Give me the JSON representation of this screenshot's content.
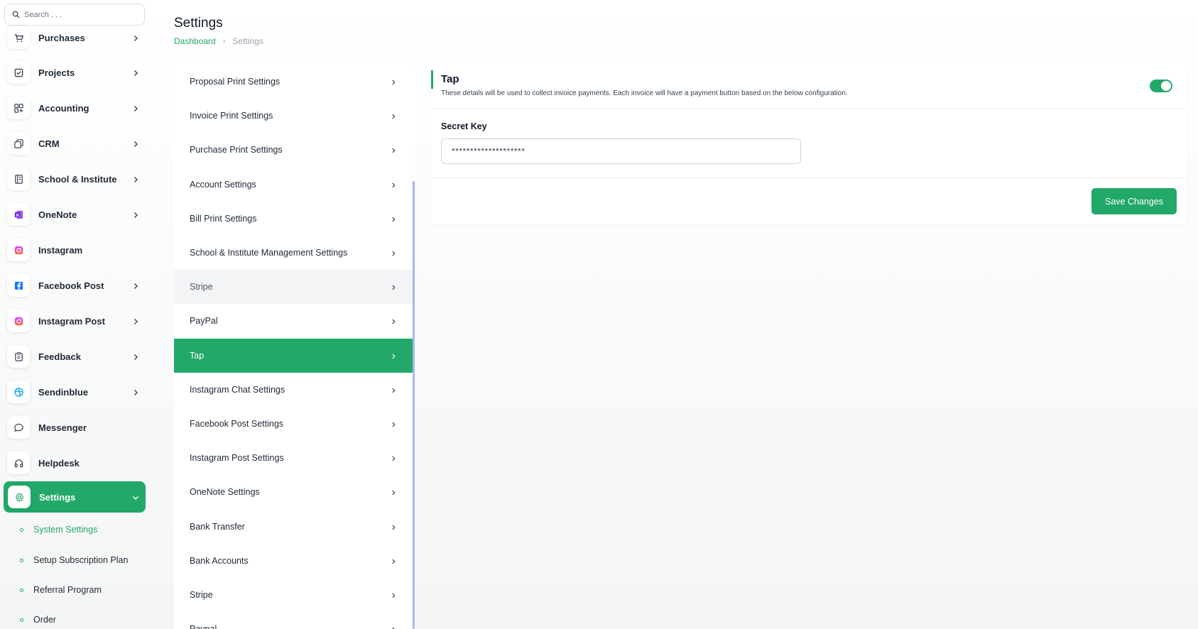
{
  "search": {
    "placeholder": "Search . . ."
  },
  "sidebar": {
    "items": [
      {
        "label": "Purchases",
        "icon": "cart-icon",
        "has_chevron": true
      },
      {
        "label": "Projects",
        "icon": "check-square-icon",
        "has_chevron": true
      },
      {
        "label": "Accounting",
        "icon": "grid-icon",
        "has_chevron": true
      },
      {
        "label": "CRM",
        "icon": "layers-icon",
        "has_chevron": true
      },
      {
        "label": "School & Institute",
        "icon": "book-icon",
        "has_chevron": true
      },
      {
        "label": "OneNote",
        "icon": "onenote-icon",
        "has_chevron": true
      },
      {
        "label": "Instagram",
        "icon": "instagram-icon",
        "has_chevron": false
      },
      {
        "label": "Facebook Post",
        "icon": "facebook-icon",
        "has_chevron": true
      },
      {
        "label": "Instagram Post",
        "icon": "instagram-icon",
        "has_chevron": true
      },
      {
        "label": "Feedback",
        "icon": "clipboard-icon",
        "has_chevron": true
      },
      {
        "label": "Sendinblue",
        "icon": "sendinblue-icon",
        "has_chevron": true
      },
      {
        "label": "Messenger",
        "icon": "chat-icon",
        "has_chevron": false
      },
      {
        "label": "Helpdesk",
        "icon": "headphones-icon",
        "has_chevron": false
      },
      {
        "label": "Settings",
        "icon": "gear-icon",
        "has_chevron": true,
        "active": true
      }
    ],
    "sub_items": [
      {
        "label": "System Settings",
        "current": true
      },
      {
        "label": "Setup Subscription Plan"
      },
      {
        "label": "Referral Program"
      },
      {
        "label": "Order"
      }
    ]
  },
  "header": {
    "title": "Settings",
    "breadcrumb": {
      "link": "Dashboard",
      "current": "Settings"
    }
  },
  "settings_list": [
    {
      "label": "Proposal Print Settings"
    },
    {
      "label": "Invoice Print Settings"
    },
    {
      "label": "Purchase Print Settings"
    },
    {
      "label": "Account Settings"
    },
    {
      "label": "Bill Print Settings"
    },
    {
      "label": "School & Institute Management Settings"
    },
    {
      "label": "Stripe",
      "state": "hover"
    },
    {
      "label": "PayPal"
    },
    {
      "label": "Tap",
      "state": "selected"
    },
    {
      "label": "Instagram Chat Settings"
    },
    {
      "label": "Facebook Post Settings"
    },
    {
      "label": "Instagram Post Settings"
    },
    {
      "label": "OneNote Settings"
    },
    {
      "label": "Bank Transfer"
    },
    {
      "label": "Bank Accounts"
    },
    {
      "label": "Stripe"
    },
    {
      "label": "Paypal"
    }
  ],
  "card": {
    "title": "Tap",
    "description": "These details will be used to collect invoice payments. Each invoice will have a payment button based on the below configuration.",
    "toggle_on": true,
    "secret_key_label": "Secret Key",
    "secret_key_value": "********************",
    "save_label": "Save Changes"
  },
  "colors": {
    "accent": "#22a869",
    "scrollbar": "#a5b4fc"
  }
}
